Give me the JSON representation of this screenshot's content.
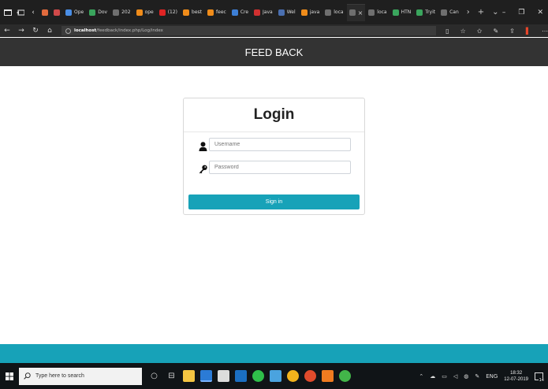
{
  "browser": {
    "tabs": [
      {
        "label": "",
        "color": "#e26b3d"
      },
      {
        "label": "",
        "color": "#d04a4a"
      },
      {
        "label": "Ope",
        "color": "#4a8ee6"
      },
      {
        "label": "Dov",
        "color": "#3aa55d"
      },
      {
        "label": "202",
        "color": "#6f6f6f"
      },
      {
        "label": "ope",
        "color": "#f08c1a"
      },
      {
        "label": "(12)",
        "color": "#e02424"
      },
      {
        "label": "best",
        "color": "#f08c1a"
      },
      {
        "label": "feec",
        "color": "#f08c1a"
      },
      {
        "label": "Cre",
        "color": "#3d7fd6"
      },
      {
        "label": "Java",
        "color": "#d03030"
      },
      {
        "label": "Wel",
        "color": "#4a6fb0"
      },
      {
        "label": "java",
        "color": "#f08c1a"
      },
      {
        "label": "loca",
        "color": "#6f6f6f"
      },
      {
        "label": "",
        "color": "#6f6f6f",
        "active": true,
        "close": "×"
      },
      {
        "label": "loca",
        "color": "#6f6f6f"
      },
      {
        "label": "HTN",
        "color": "#3aa55d"
      },
      {
        "label": "Tryit",
        "color": "#3aa55d"
      },
      {
        "label": "Can",
        "color": "#6f6f6f"
      }
    ],
    "url_host": "localhost",
    "url_path": "/feedback/index.php/Log/index"
  },
  "header": {
    "title": "FEED BACK"
  },
  "login": {
    "title": "Login",
    "username_placeholder": "Username",
    "password_placeholder": "Password",
    "signin_label": "Sign in"
  },
  "colors": {
    "header_bg": "#333333",
    "accent": "#17a2b8"
  },
  "taskbar": {
    "search_placeholder": "Type here to search",
    "language": "ENG",
    "time": "18:32",
    "date": "12-07-2019",
    "notification_count": "14"
  }
}
